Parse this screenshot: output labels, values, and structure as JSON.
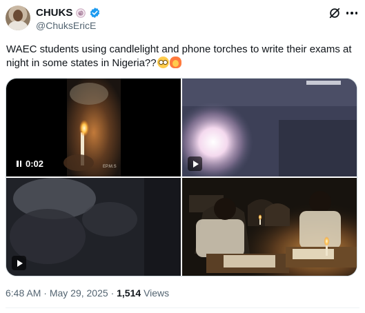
{
  "author": {
    "name": "CHUKS",
    "handle": "@ChuksEricE"
  },
  "tweet": {
    "text": "WAEC students using candlelight and phone torches to write their exams at night in some states in Nigeria??"
  },
  "media": {
    "tiles": [
      {
        "kind": "video",
        "state": "playing",
        "time": "0:02"
      },
      {
        "kind": "video",
        "state": "paused"
      },
      {
        "kind": "video",
        "state": "paused"
      },
      {
        "kind": "image"
      }
    ],
    "watermark": "EP.M.S"
  },
  "meta": {
    "time": "6:48 AM",
    "separator": "·",
    "date": "May 29, 2025",
    "views_count": "1,514",
    "views_label": "Views"
  },
  "icons": {
    "verified": "verified-badge-icon",
    "label_badge": "spiral-badge-icon",
    "grok": "grok-icon",
    "more": "more-icon"
  },
  "colors": {
    "verified": "#1d9bf0",
    "text": "#0f1419",
    "secondary": "#536471"
  }
}
